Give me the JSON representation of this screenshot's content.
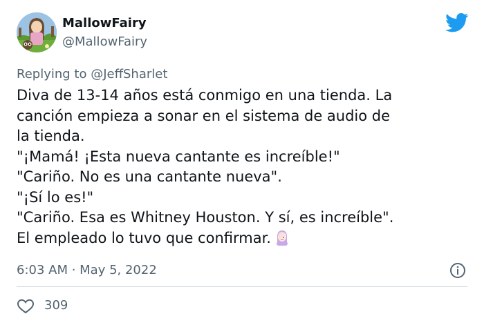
{
  "author": {
    "display_name": "MallowFairy",
    "handle": "@MallowFairy"
  },
  "reply_to": "Replying to @JeffSharlet",
  "tweet": {
    "lines": [
      "Diva de 13-14 años está conmigo en una tienda. La",
      "canción empieza a sonar en el sistema de audio de",
      "la tienda.",
      "\"¡Mamá! ¡Esta nueva cantante es increíble!\"",
      "\"Cariño. No es una cantante nueva\".",
      "\"¡Sí lo es!\"",
      "\"Cariño. Esa es Whitney Houston. Y sí, es increíble\".",
      "El empleado lo tuvo que confirmar."
    ],
    "emoji": "woman-facepalming-icon"
  },
  "timestamp": "6:03 AM · May 5, 2022",
  "likes": {
    "count": "309",
    "icon": "heart-icon"
  },
  "colors": {
    "twitter_blue": "#1d9bf0",
    "secondary_text": "#536471",
    "primary_text": "#0f1419",
    "divider": "#cfd9de"
  }
}
